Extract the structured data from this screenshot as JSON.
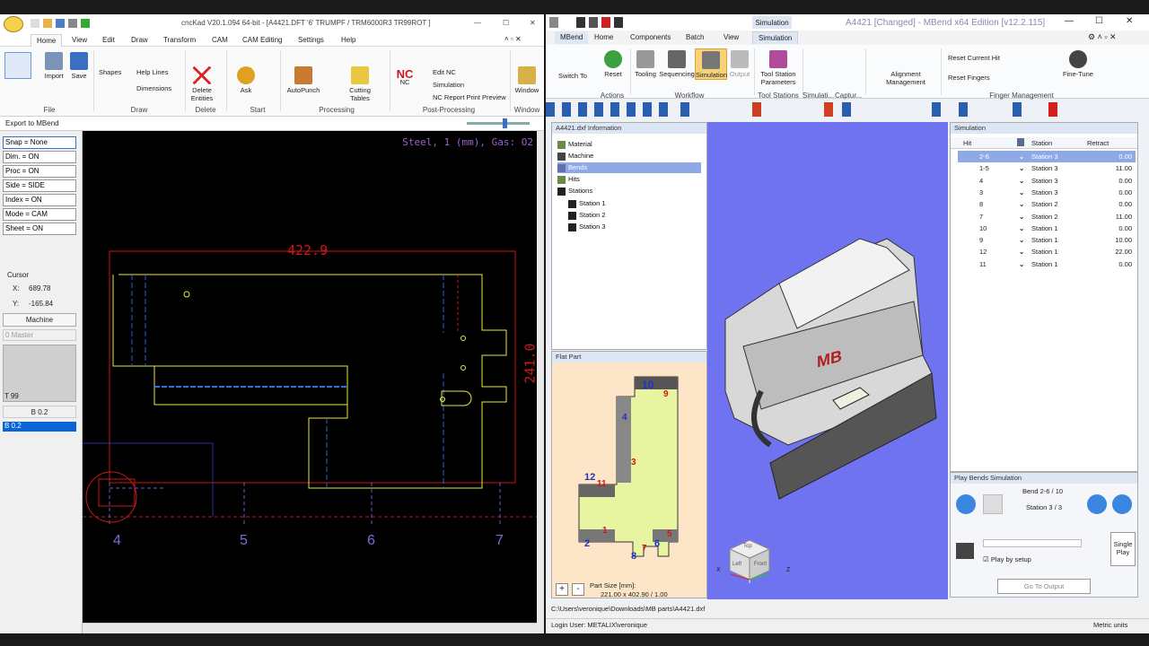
{
  "left_app": {
    "title": "cncKad V20.1.094 64-bit - [A4421.DFT    '6' TRUMPF / TRM6000R3 TR99ROT  ]",
    "tabs": [
      "Home",
      "View",
      "Edit",
      "Draw",
      "Transform",
      "CAM",
      "CAM Editing",
      "Settings",
      "Help"
    ],
    "active_tab": "Home",
    "ribbon": {
      "import": "Import",
      "save": "Save",
      "file_group": "File",
      "shapes": "Shapes",
      "help_lines": "Help Lines",
      "dimensions": "Dimensions",
      "draw_group": "Draw",
      "delete_entities": "Delete Entities",
      "delete_group": "Delete",
      "ask": "Ask",
      "start_group": "Start",
      "autopunch": "AutoPunch",
      "cutting_tables": "Cutting Tables",
      "processing_group": "Processing",
      "nc": "NC",
      "nc_logo": "NC",
      "edit_nc": "Edit NC",
      "simulation": "Simulation",
      "nc_report": "NC Report Print Preview",
      "postprocessing_group": "Post-Processing",
      "window": "Window",
      "window_group": "Window"
    },
    "command_line": "Export to MBend",
    "left_panel": {
      "rows": [
        "Snap = None",
        "Dim. = ON",
        "Proc = ON",
        "Side = SIDE",
        "Index = ON",
        "Mode = CAM",
        "Sheet = ON"
      ],
      "cursor_label": "Cursor",
      "cursor_x_label": "X:",
      "cursor_x": "689.78",
      "cursor_y_label": "Y:",
      "cursor_y": "-165.84",
      "machine_btn": "Machine",
      "master_select": "0 Master",
      "tool_t": "T 99",
      "tool_b": "B 0.2",
      "tool_b_selected": "B 0.2"
    },
    "canvas": {
      "material_info": "Steel, 1 (mm), Gas: O2",
      "dim_width": "422.9",
      "dim_height": "241.0",
      "grid_labels": [
        "4",
        "5",
        "6",
        "7"
      ]
    }
  },
  "right_app": {
    "title": "A4421 [Changed] - MBend x64 Edition [v12.2.115]",
    "context_tab": "Simulation",
    "tabs": [
      "MBend",
      "Home",
      "Components",
      "Batch",
      "View",
      "Simulation"
    ],
    "active_tab": "Simulation",
    "ribbon": {
      "switch_to": "Switch To",
      "reset": "Reset",
      "actions_group": "Actions",
      "tooling": "Tooling",
      "sequencing": "Sequencing",
      "simulation": "Simulation",
      "output": "Output",
      "workflow_group": "Workflow",
      "tool_station_params": "Tool Station Parameters",
      "tool_stations_group": "Tool Stations",
      "simulati_group": "Simulati...",
      "captur_group": "Captur...",
      "alignment": "Alignment Management",
      "reset_current_hit": "Reset Current Hit",
      "reset_fingers": "Reset Fingers",
      "fine_tune": "Fine-Tune",
      "finger_group": "Finger Management"
    },
    "info_panel": {
      "title": "A4421.dxf Information",
      "items": [
        "Material",
        "Machine",
        "Bends",
        "Hits",
        "Stations"
      ],
      "stations": [
        "Station 1",
        "Station 2",
        "Station 3"
      ]
    },
    "flat_part": {
      "title": "Flat Part",
      "size_label": "Part Size [mm]:",
      "size_value": "221.00 x 402.90 / 1.00",
      "bend_numbers": [
        "10",
        "9",
        "4",
        "3",
        "12",
        "11",
        "1",
        "2",
        "5",
        "6",
        "7",
        "8"
      ]
    },
    "viewport": {
      "logo": "MB",
      "cube_top": "Top",
      "cube_left": "Left",
      "cube_front": "Front",
      "axis_x": "X",
      "axis_z": "Z"
    },
    "simulation_panel": {
      "title": "Simulation",
      "columns": [
        "Hit",
        "Station",
        "Retract"
      ],
      "rows": [
        {
          "hit": "2-6",
          "station": "Station 3",
          "retract": "0.00",
          "selected": true
        },
        {
          "hit": "1-5",
          "station": "Station 3",
          "retract": "11.00",
          "selected": false
        },
        {
          "hit": "4",
          "station": "Station 3",
          "retract": "0.00",
          "selected": false
        },
        {
          "hit": "3",
          "station": "Station 3",
          "retract": "0.00",
          "selected": false
        },
        {
          "hit": "8",
          "station": "Station 2",
          "retract": "0.00",
          "selected": false
        },
        {
          "hit": "7",
          "station": "Station 2",
          "retract": "11.00",
          "selected": false
        },
        {
          "hit": "10",
          "station": "Station 1",
          "retract": "0.00",
          "selected": false
        },
        {
          "hit": "9",
          "station": "Station 1",
          "retract": "10.00",
          "selected": false
        },
        {
          "hit": "12",
          "station": "Station 1",
          "retract": "22.00",
          "selected": false
        },
        {
          "hit": "11",
          "station": "Station 1",
          "retract": "0.00",
          "selected": false
        }
      ]
    },
    "play_panel": {
      "title": "Play Bends Simulation",
      "bend_status": "Bend 2-6 / 10",
      "station_status": "Station 3 / 3",
      "play_by_setup": "Play by setup",
      "single_play": "Single Play",
      "goto_output": "Go To Output"
    },
    "status": {
      "path": "C:\\Users\\veronique\\Downloads\\MB parts\\A4421.dxf",
      "login": "Login User: METALIX\\veronique",
      "units": "Metric units"
    }
  },
  "colors": {
    "viewport_bg": "#6f73f0",
    "flat_bg": "#fde6c8",
    "part_fill": "#e8f5a0",
    "selection": "#8fa9e8",
    "cad_red": "#d01818",
    "cad_yellow": "#e8e840"
  }
}
